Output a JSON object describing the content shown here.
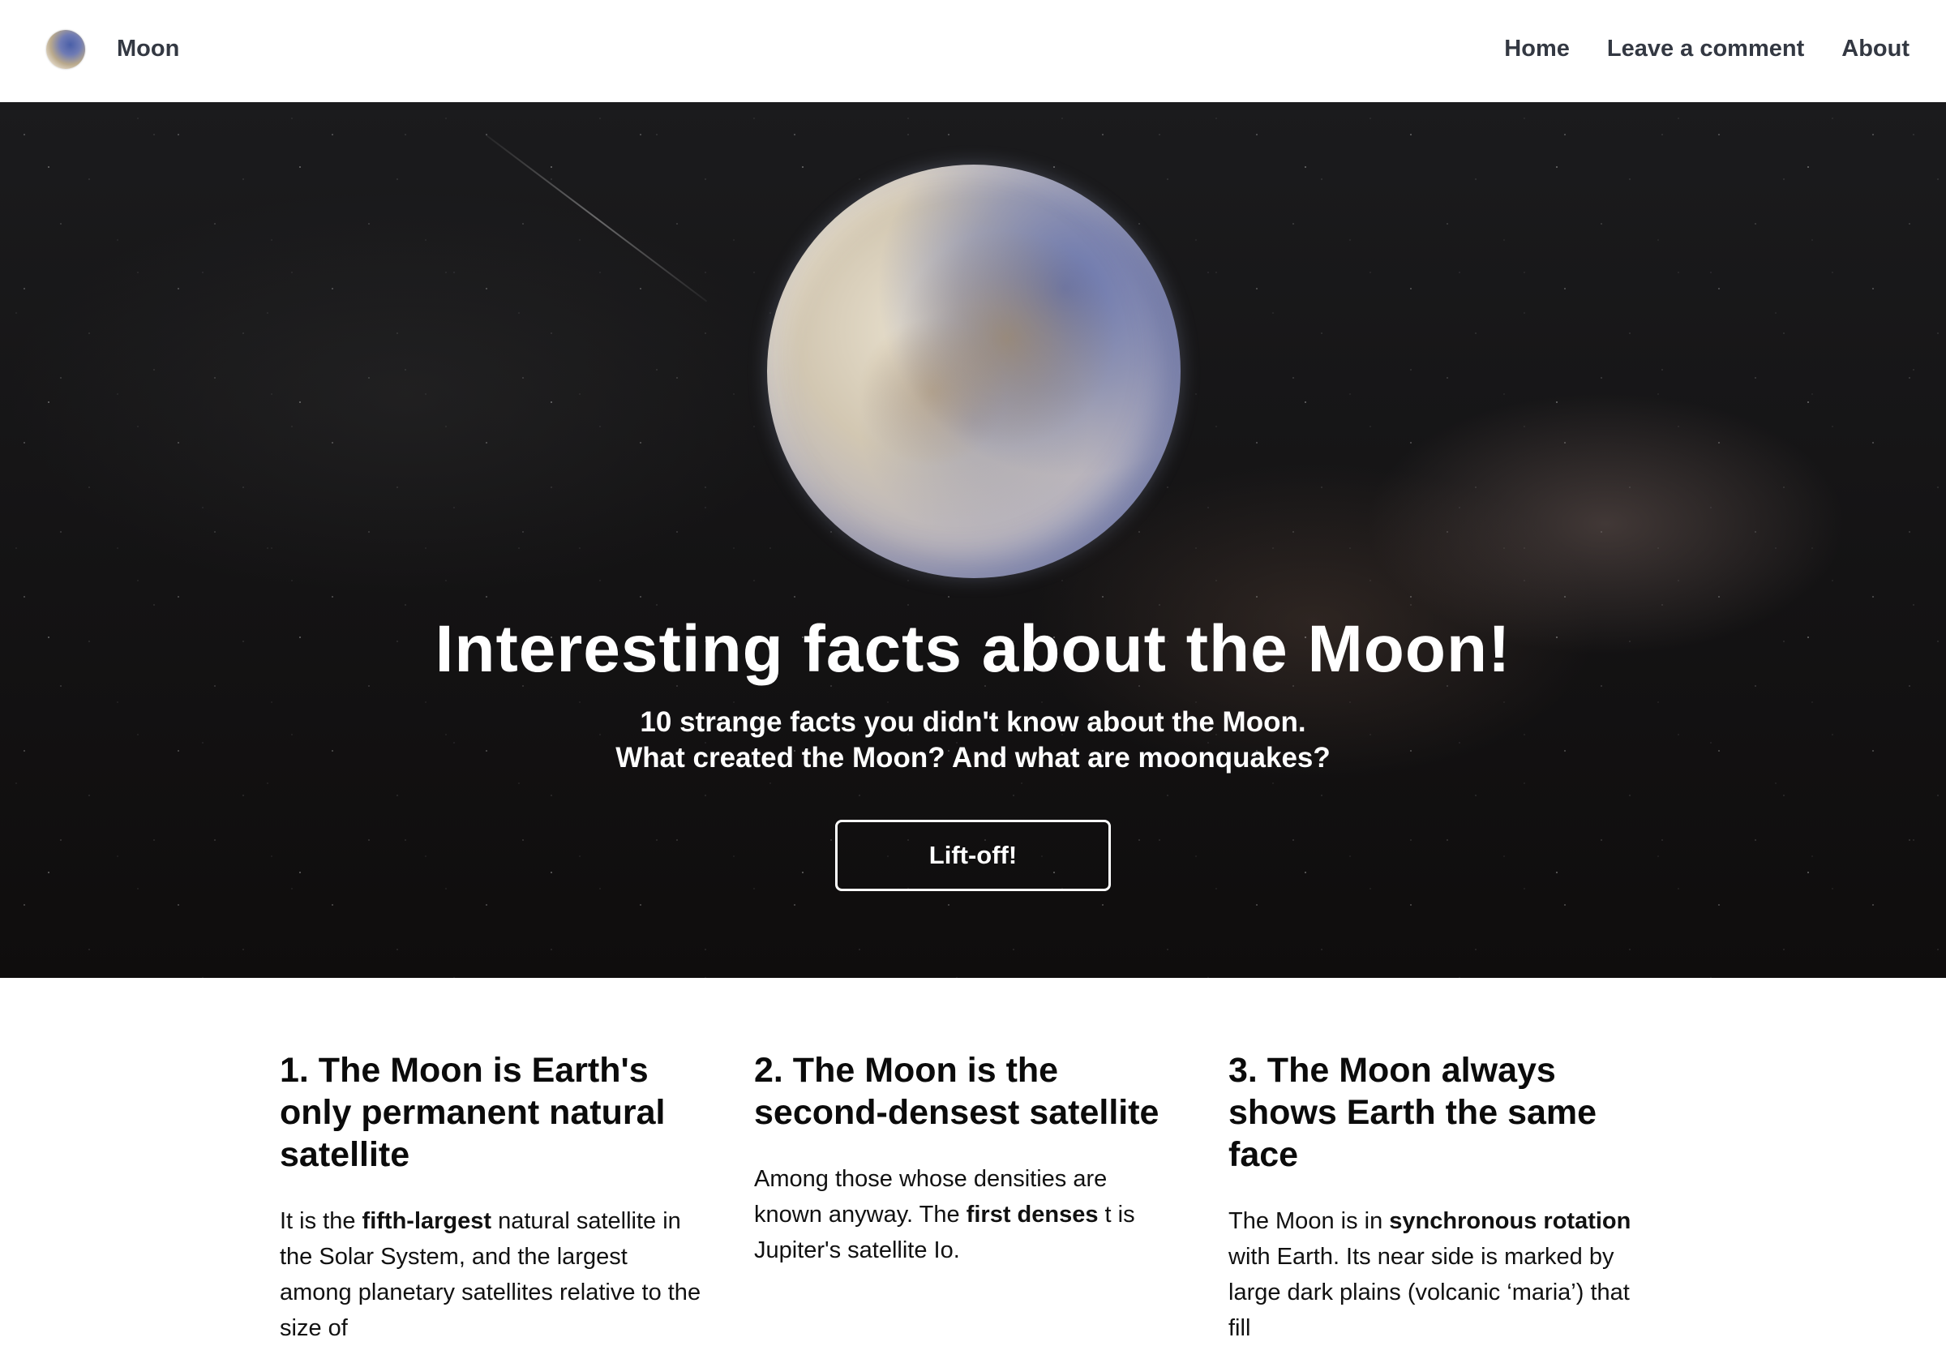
{
  "header": {
    "brand": "Moon",
    "nav": [
      "Home",
      "Leave a comment",
      "About"
    ]
  },
  "hero": {
    "title": "Interesting facts about the Moon!",
    "subtitle_line1": "10 strange facts you didn't know about the Moon.",
    "subtitle_line2": "What created the Moon? And what are moonquakes?",
    "button": "Lift-off!"
  },
  "facts": [
    {
      "title": "1. The Moon is Earth's only permanent natural satellite",
      "text_pre": "It is the ",
      "text_bold": "fifth-largest",
      "text_post": " natural satellite in the Solar System, and the largest among planetary satellites relative to the size of"
    },
    {
      "title": "2. The Moon is the second-densest satellite",
      "text_pre": "Among those whose densities are known anyway. The ",
      "text_bold": "first denses",
      "text_post": " t is Jupiter's satellite Io."
    },
    {
      "title": "3. The Moon always shows Earth the same face",
      "text_pre": "The Moon is in ",
      "text_bold": "synchronous rotation",
      "text_post": " with Earth. Its near side is marked by large dark plains (volcanic ‘maria’) that fill"
    }
  ]
}
